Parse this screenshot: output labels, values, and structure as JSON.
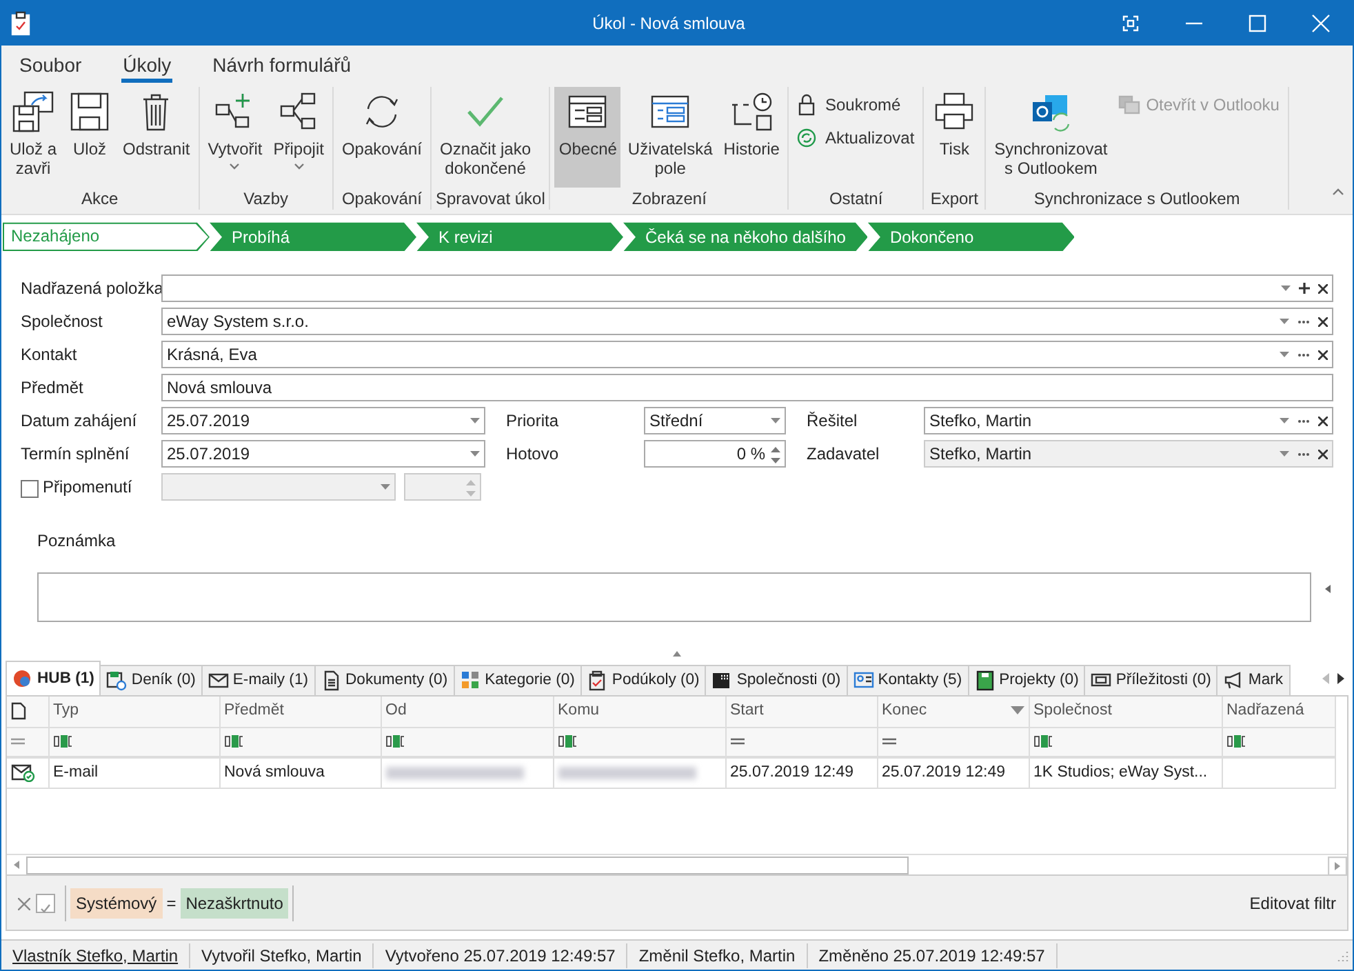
{
  "window": {
    "title": "Úkol - Nová smlouva"
  },
  "menu_tabs": [
    {
      "label": "Soubor",
      "selected": false
    },
    {
      "label": "Úkoly",
      "selected": true
    },
    {
      "label": "Návrh formulářů",
      "selected": false
    }
  ],
  "ribbon": [
    {
      "label": "Akce",
      "buttons": [
        {
          "label": "Ulož a\nzavři",
          "kind": "large"
        },
        {
          "label": "Ulož",
          "kind": "large"
        },
        {
          "label": "Odstranit",
          "kind": "large"
        }
      ]
    },
    {
      "label": "Vazby",
      "buttons": [
        {
          "label": "Vytvořit",
          "kind": "large",
          "dropdown": true
        },
        {
          "label": "Připojit",
          "kind": "large",
          "dropdown": true
        }
      ]
    },
    {
      "label": "Opakování",
      "buttons": [
        {
          "label": "Opakování",
          "kind": "large"
        }
      ]
    },
    {
      "label": "Spravovat úkol",
      "buttons": [
        {
          "label": "Označit jako\ndokončené",
          "kind": "large"
        }
      ]
    },
    {
      "label": "Zobrazení",
      "buttons": [
        {
          "label": "Obecné",
          "kind": "large",
          "selected": true
        },
        {
          "label": "Uživatelská\npole",
          "kind": "large",
          "selected": false
        },
        {
          "label": "Historie",
          "kind": "large",
          "selected": false
        }
      ]
    },
    {
      "label": "Ostatní",
      "buttons": [
        {
          "label": "Soukromé",
          "kind": "small"
        },
        {
          "label": "Aktualizovat",
          "kind": "small"
        }
      ]
    },
    {
      "label": "Export",
      "buttons": [
        {
          "label": "Tisk",
          "kind": "large"
        }
      ]
    },
    {
      "label": "Synchronizace s Outlookem",
      "buttons": [
        {
          "label": "Synchronizovat\ns Outlookem",
          "kind": "large",
          "disabled": false
        },
        {
          "label": "Otevřít v Outlooku",
          "kind": "small",
          "disabled": true
        }
      ]
    }
  ],
  "stages": [
    {
      "label": "Nezahájeno",
      "selected": true
    },
    {
      "label": "Probíhá",
      "selected": false
    },
    {
      "label": "K revizi",
      "selected": false
    },
    {
      "label": "Čeká se na někoho dalšího",
      "selected": false
    },
    {
      "label": "Dokončeno",
      "selected": false
    }
  ],
  "form": {
    "rows": [
      [
        {
          "label": "Nadřazená položka",
          "kind": "parentlookup",
          "disabled": false
        }
      ],
      [
        {
          "label": "Společnost",
          "value": "eWay System s.r.o.",
          "kind": "lookup",
          "disabled": false
        }
      ],
      [
        {
          "label": "Kontakt",
          "value": "Krásná, Eva",
          "kind": "lookup",
          "disabled": false
        }
      ],
      [
        {
          "label": "Předmět",
          "value": "Nová smlouva",
          "kind": "text",
          "disabled": false
        }
      ],
      [
        {
          "label": "Datum zahájení",
          "value": "25.07.2019",
          "kind": "select",
          "disabled": false
        },
        {
          "label": "Priorita",
          "value": "Střední",
          "kind": "select",
          "disabled": false
        },
        {
          "label": "Řešitel",
          "value": "Stefko, Martin",
          "kind": "lookup",
          "disabled": false
        }
      ],
      [
        {
          "label": "Termín splnění",
          "value": "25.07.2019",
          "kind": "select",
          "disabled": false
        },
        {
          "label": "Hotovo",
          "value": "0 %",
          "kind": "spin",
          "disabled": false
        },
        {
          "label": "Zadavatel",
          "value": "Stefko, Martin",
          "kind": "lookup",
          "disabled": true
        }
      ],
      [
        {
          "label": "Připomenutí",
          "kind": "checkbox",
          "checked": false
        },
        {
          "kind": "select",
          "disabled": true
        },
        {
          "kind": "spin",
          "disabled": true
        }
      ]
    ],
    "note_label": "Poznámka"
  },
  "tabs": [
    {
      "label": "HUB (1)",
      "selected": true
    },
    {
      "label": "Deník (0)",
      "selected": false
    },
    {
      "label": "E-maily (1)",
      "selected": false
    },
    {
      "label": "Dokumenty (0)",
      "selected": false
    },
    {
      "label": "Kategorie (0)",
      "selected": false
    },
    {
      "label": "Podúkoly (0)",
      "selected": false
    },
    {
      "label": "Společnosti (0)",
      "selected": false
    },
    {
      "label": "Kontakty (5)",
      "selected": false
    },
    {
      "label": "Projekty (0)",
      "selected": false
    },
    {
      "label": "Příležitosti (0)",
      "selected": false
    },
    {
      "label": "Mark",
      "selected": false
    }
  ],
  "table": {
    "columns": [
      {
        "label": "Typ",
        "kind": "text",
        "sorted": false
      },
      {
        "label": "Předmět",
        "kind": "text",
        "sorted": false
      },
      {
        "label": "Od",
        "kind": "text",
        "sorted": false
      },
      {
        "label": "Komu",
        "kind": "text",
        "sorted": false
      },
      {
        "label": "Start",
        "kind": "date",
        "sorted": false
      },
      {
        "label": "Konec",
        "kind": "date",
        "sorted": true
      },
      {
        "label": "Společnost",
        "kind": "text",
        "sorted": false
      },
      {
        "label": "Nadřazená",
        "kind": "text",
        "sorted": false
      }
    ],
    "rows": [
      {
        "cells": [
          {
            "text": "E-mail"
          },
          {
            "text": "Nová smlouva"
          },
          {
            "redacted": true
          },
          {
            "redacted": true
          },
          {
            "text": "25.07.2019 12:49"
          },
          {
            "text": "25.07.2019 12:49"
          },
          {
            "text": "1K Studios; eWay Syst..."
          }
        ]
      }
    ]
  },
  "filter": {
    "enabled": true,
    "field": "Systémový",
    "operator": "=",
    "value": "Nezaškrtnuto",
    "edit_link": "Editovat filtr"
  },
  "status_bar": [
    {
      "text": "Vlastník Stefko, Martin",
      "kind": "link"
    },
    {
      "text": "Vytvořil Stefko, Martin",
      "kind": "text"
    },
    {
      "text": "Vytvořeno 25.07.2019 12:49:57",
      "kind": "text"
    },
    {
      "text": "Změnil Stefko, Martin",
      "kind": "text"
    },
    {
      "text": "Změněno 25.07.2019 12:49:57",
      "kind": "text"
    }
  ]
}
